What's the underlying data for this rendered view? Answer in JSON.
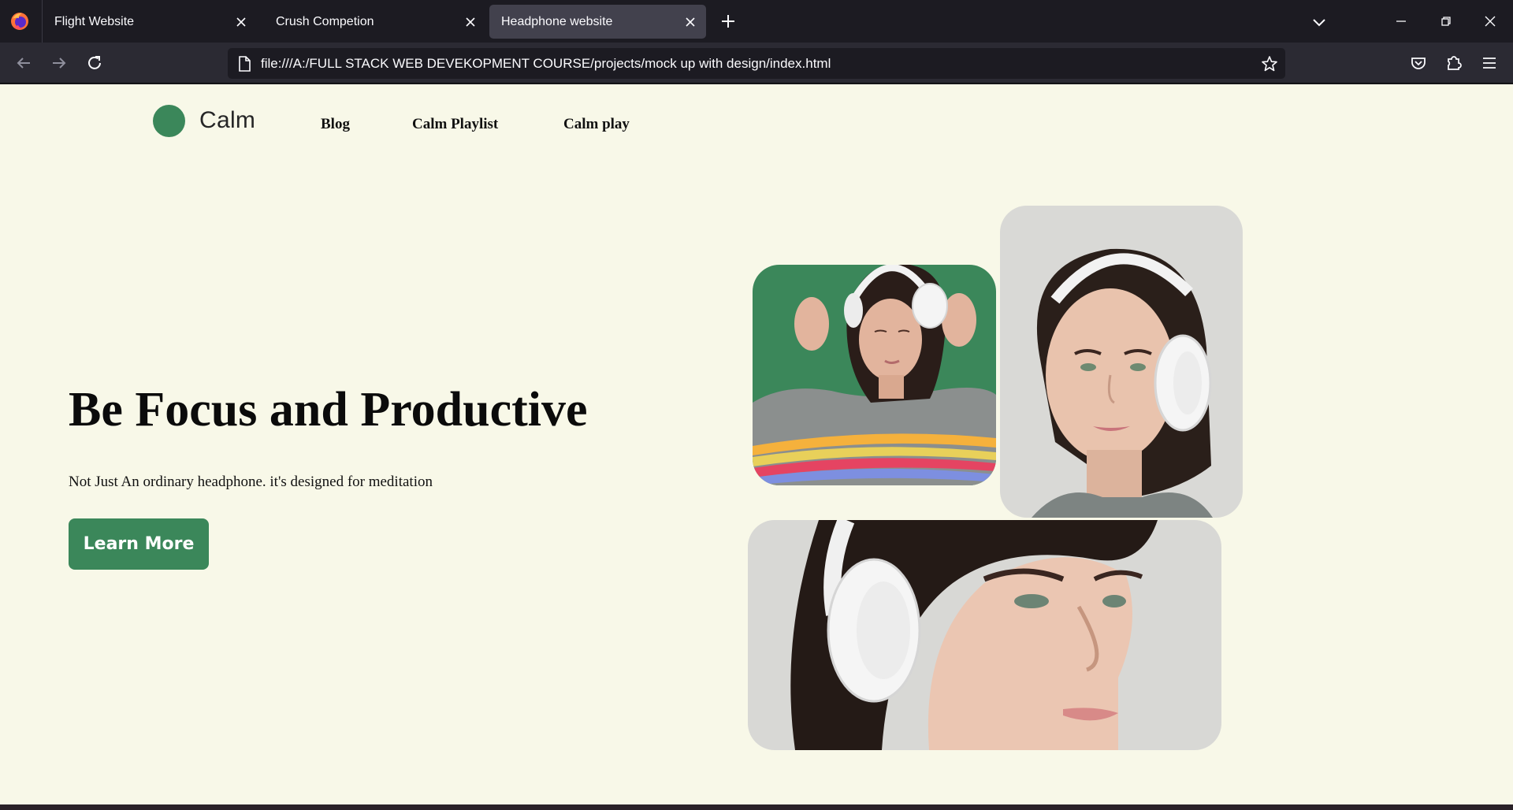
{
  "browser": {
    "tabs": [
      {
        "label": "Flight Website",
        "active": false
      },
      {
        "label": "Crush Competion",
        "active": false
      },
      {
        "label": "Headphone website",
        "active": true
      }
    ],
    "url": "file:///A:/FULL STACK WEB DEVEKOPMENT COURSE/projects/mock up with design/index.html",
    "icons": {
      "back": "arrow-left-icon",
      "forward": "arrow-right-icon",
      "reload": "reload-icon",
      "bookmark": "star-icon",
      "pocket": "pocket-icon",
      "extensions": "puzzle-icon",
      "menu": "hamburger-icon"
    }
  },
  "site": {
    "brand": "Calm",
    "nav": [
      "Blog",
      "Calm Playlist",
      "Calm play"
    ],
    "hero": {
      "title": "Be Focus and Productive",
      "subtitle": "Not Just An ordinary headphone. it's designed for meditation",
      "cta": "Learn More"
    },
    "colors": {
      "accent": "#3b875a",
      "background": "#f8f8e8",
      "chrome_dark": "#1c1b22",
      "chrome_mid": "#2b2a33",
      "active_tab": "#42414d"
    }
  }
}
